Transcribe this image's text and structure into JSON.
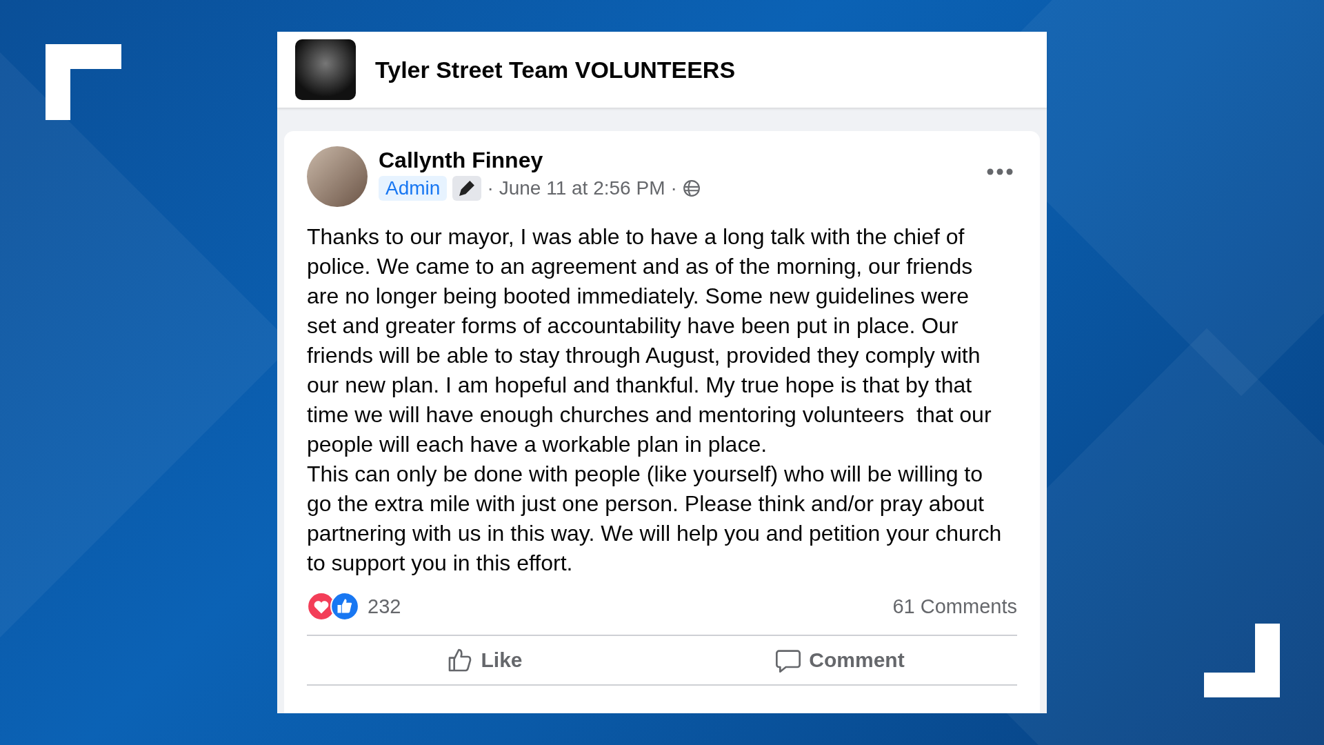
{
  "group": {
    "name": "Tyler Street Team VOLUNTEERS"
  },
  "post": {
    "author": "Callynth Finney",
    "badge": "Admin",
    "separators": [
      "·",
      "·"
    ],
    "time": "June 11 at 2:56 PM",
    "paragraphs": [
      "Thanks to our mayor, I was able to have a long talk with the chief of police. We came to an agreement and as of the morning, our friends are no longer being booted immediately. Some new guidelines were set and greater forms of accountability have been put in place. Our friends will be able to stay through August, provided they comply with our new plan. I am hopeful and thankful. My true hope is that by that time we will have enough churches and mentoring volunteers  that our people will each have a workable plan in place.",
      "This can only be done with people (like yourself) who will be willing to go the extra mile with just one person. Please think and/or pray about partnering with us in this way. We will help you and petition your church to support you in this effort."
    ],
    "reactions_count": "232",
    "comments_count": "61 Comments",
    "actions": [
      {
        "kind": "like",
        "label": "Like"
      },
      {
        "kind": "comment",
        "label": "Comment"
      }
    ]
  }
}
